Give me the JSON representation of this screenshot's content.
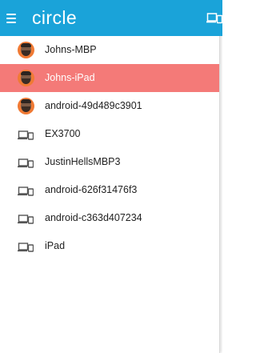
{
  "app": {
    "title": "circle"
  },
  "icons": {
    "menu": "hamburger-menu-icon",
    "devices": "laptop-phone-icon"
  },
  "colors": {
    "header": "#1aa3d9",
    "selected_row": "#f47a78",
    "avatar_bg": "#f07a34"
  },
  "devices": [
    {
      "label": "Johns-MBP",
      "type": "avatar",
      "selected": false
    },
    {
      "label": "Johns-iPad",
      "type": "avatar",
      "selected": true
    },
    {
      "label": "android-49d489c3901",
      "type": "avatar",
      "selected": false
    },
    {
      "label": "EX3700",
      "type": "device",
      "selected": false
    },
    {
      "label": "JustinHellsMBP3",
      "type": "device",
      "selected": false
    },
    {
      "label": "android-626f31476f3",
      "type": "device",
      "selected": false
    },
    {
      "label": "android-c363d407234",
      "type": "device",
      "selected": false
    },
    {
      "label": "iPad",
      "type": "device",
      "selected": false
    }
  ]
}
